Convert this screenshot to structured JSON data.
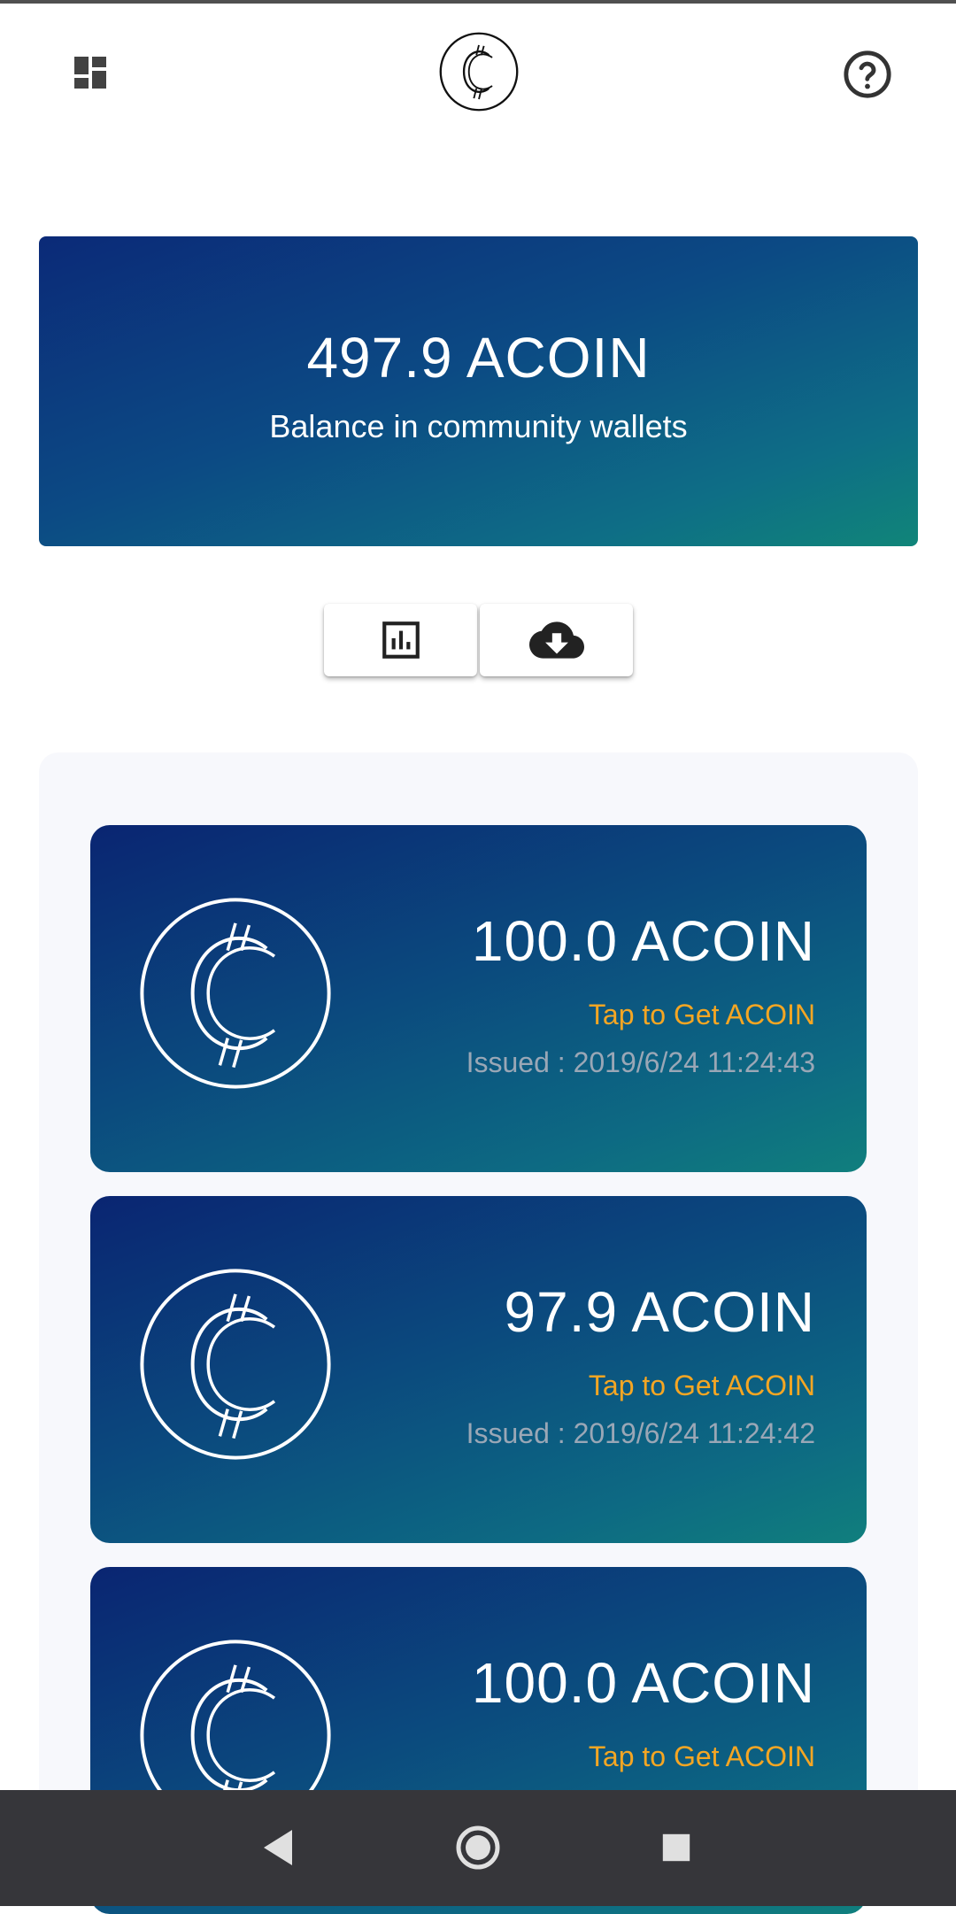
{
  "header": {
    "dashboard_icon": "dashboard-icon",
    "logo_icon": "coin-logo-icon",
    "help_icon": "help-circle-icon"
  },
  "balance": {
    "amount": "497.9 ACOIN",
    "label": "Balance in community wallets"
  },
  "actions": [
    {
      "icon": "bar-chart-icon"
    },
    {
      "icon": "cloud-download-icon"
    }
  ],
  "coins": [
    {
      "amount": "100.0 ACOIN",
      "action": "Tap to Get ACOIN",
      "issued": "Issued : 2019/6/24 11:24:43"
    },
    {
      "amount": "97.9 ACOIN",
      "action": "Tap to Get ACOIN",
      "issued": "Issued : 2019/6/24 11:24:42"
    },
    {
      "amount": "100.0 ACOIN",
      "action": "Tap to Get ACOIN",
      "issued": ""
    }
  ],
  "colors": {
    "accent_orange": "#f5a623",
    "card_gradient_start": "#0a2572",
    "card_gradient_end": "#107f7d",
    "navbar": "#36363a"
  },
  "navbar": {
    "back_icon": "back-triangle-icon",
    "home_icon": "home-circle-icon",
    "recent_icon": "recent-square-icon"
  }
}
